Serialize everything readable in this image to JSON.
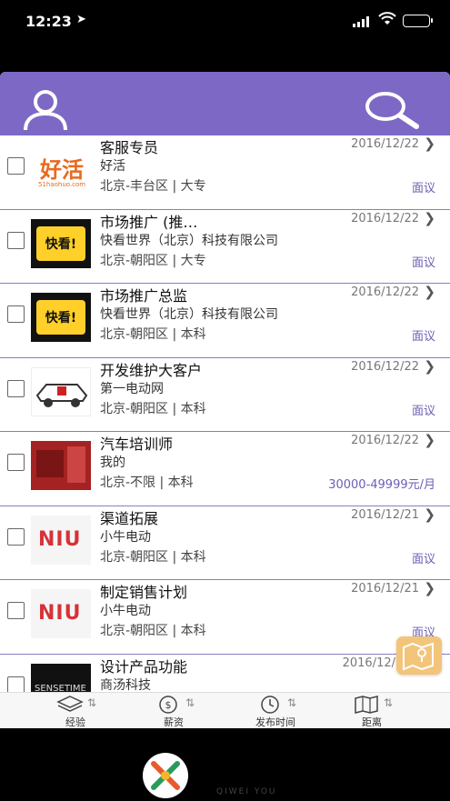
{
  "status_bar": {
    "time": "12:23"
  },
  "list": [
    {
      "title": "客服专员",
      "company": "好活",
      "location": "北京-丰台区 | 大专",
      "date": "2016/12/22",
      "salary": "面议",
      "logo": "haohuo"
    },
    {
      "title": "市场推广 (推…",
      "company": "快看世界（北京）科技有限公司",
      "location": "北京-朝阳区 | 大专",
      "date": "2016/12/22",
      "salary": "面议",
      "logo": "kuaikan"
    },
    {
      "title": "市场推广总监",
      "company": "快看世界（北京）科技有限公司",
      "location": "北京-朝阳区 | 本科",
      "date": "2016/12/22",
      "salary": "面议",
      "logo": "kuaikan"
    },
    {
      "title": "开发维护大客户",
      "company": "第一电动网",
      "location": "北京-朝阳区 | 本科",
      "date": "2016/12/22",
      "salary": "面议",
      "logo": "diandong"
    },
    {
      "title": "汽车培训师",
      "company": "我的",
      "location": "北京-不限 | 本科",
      "date": "2016/12/22",
      "salary": "30000-49999元/月",
      "logo": "wode"
    },
    {
      "title": "渠道拓展",
      "company": "小牛电动",
      "location": "北京-朝阳区 | 本科",
      "date": "2016/12/21",
      "salary": "面议",
      "logo": "niu"
    },
    {
      "title": "制定销售计划",
      "company": "小牛电动",
      "location": "北京-朝阳区 | 本科",
      "date": "2016/12/21",
      "salary": "面议",
      "logo": "niu"
    },
    {
      "title": "设计产品功能",
      "company": "商汤科技",
      "location": "",
      "date": "2016/12/",
      "salary": "",
      "logo": "sense"
    }
  ],
  "logos": {
    "haohuo_text": "好活",
    "haohuo_sub": "51haohuo.com",
    "kuaikan_text": "快看!",
    "niu_text": "NIU",
    "sense_text": "SENSETIME"
  },
  "tabs": [
    {
      "label": "经验",
      "icon": "layers-icon"
    },
    {
      "label": "薪资",
      "icon": "money-icon"
    },
    {
      "label": "发布时间",
      "icon": "clock-icon"
    },
    {
      "label": "距离",
      "icon": "map-icon"
    }
  ],
  "watermark": "QIWEI YOU",
  "colors": {
    "header": "#7d69c5",
    "salary": "#6b5fb4",
    "divider": "#8a7cc4",
    "map_button": "#f2c57b"
  }
}
